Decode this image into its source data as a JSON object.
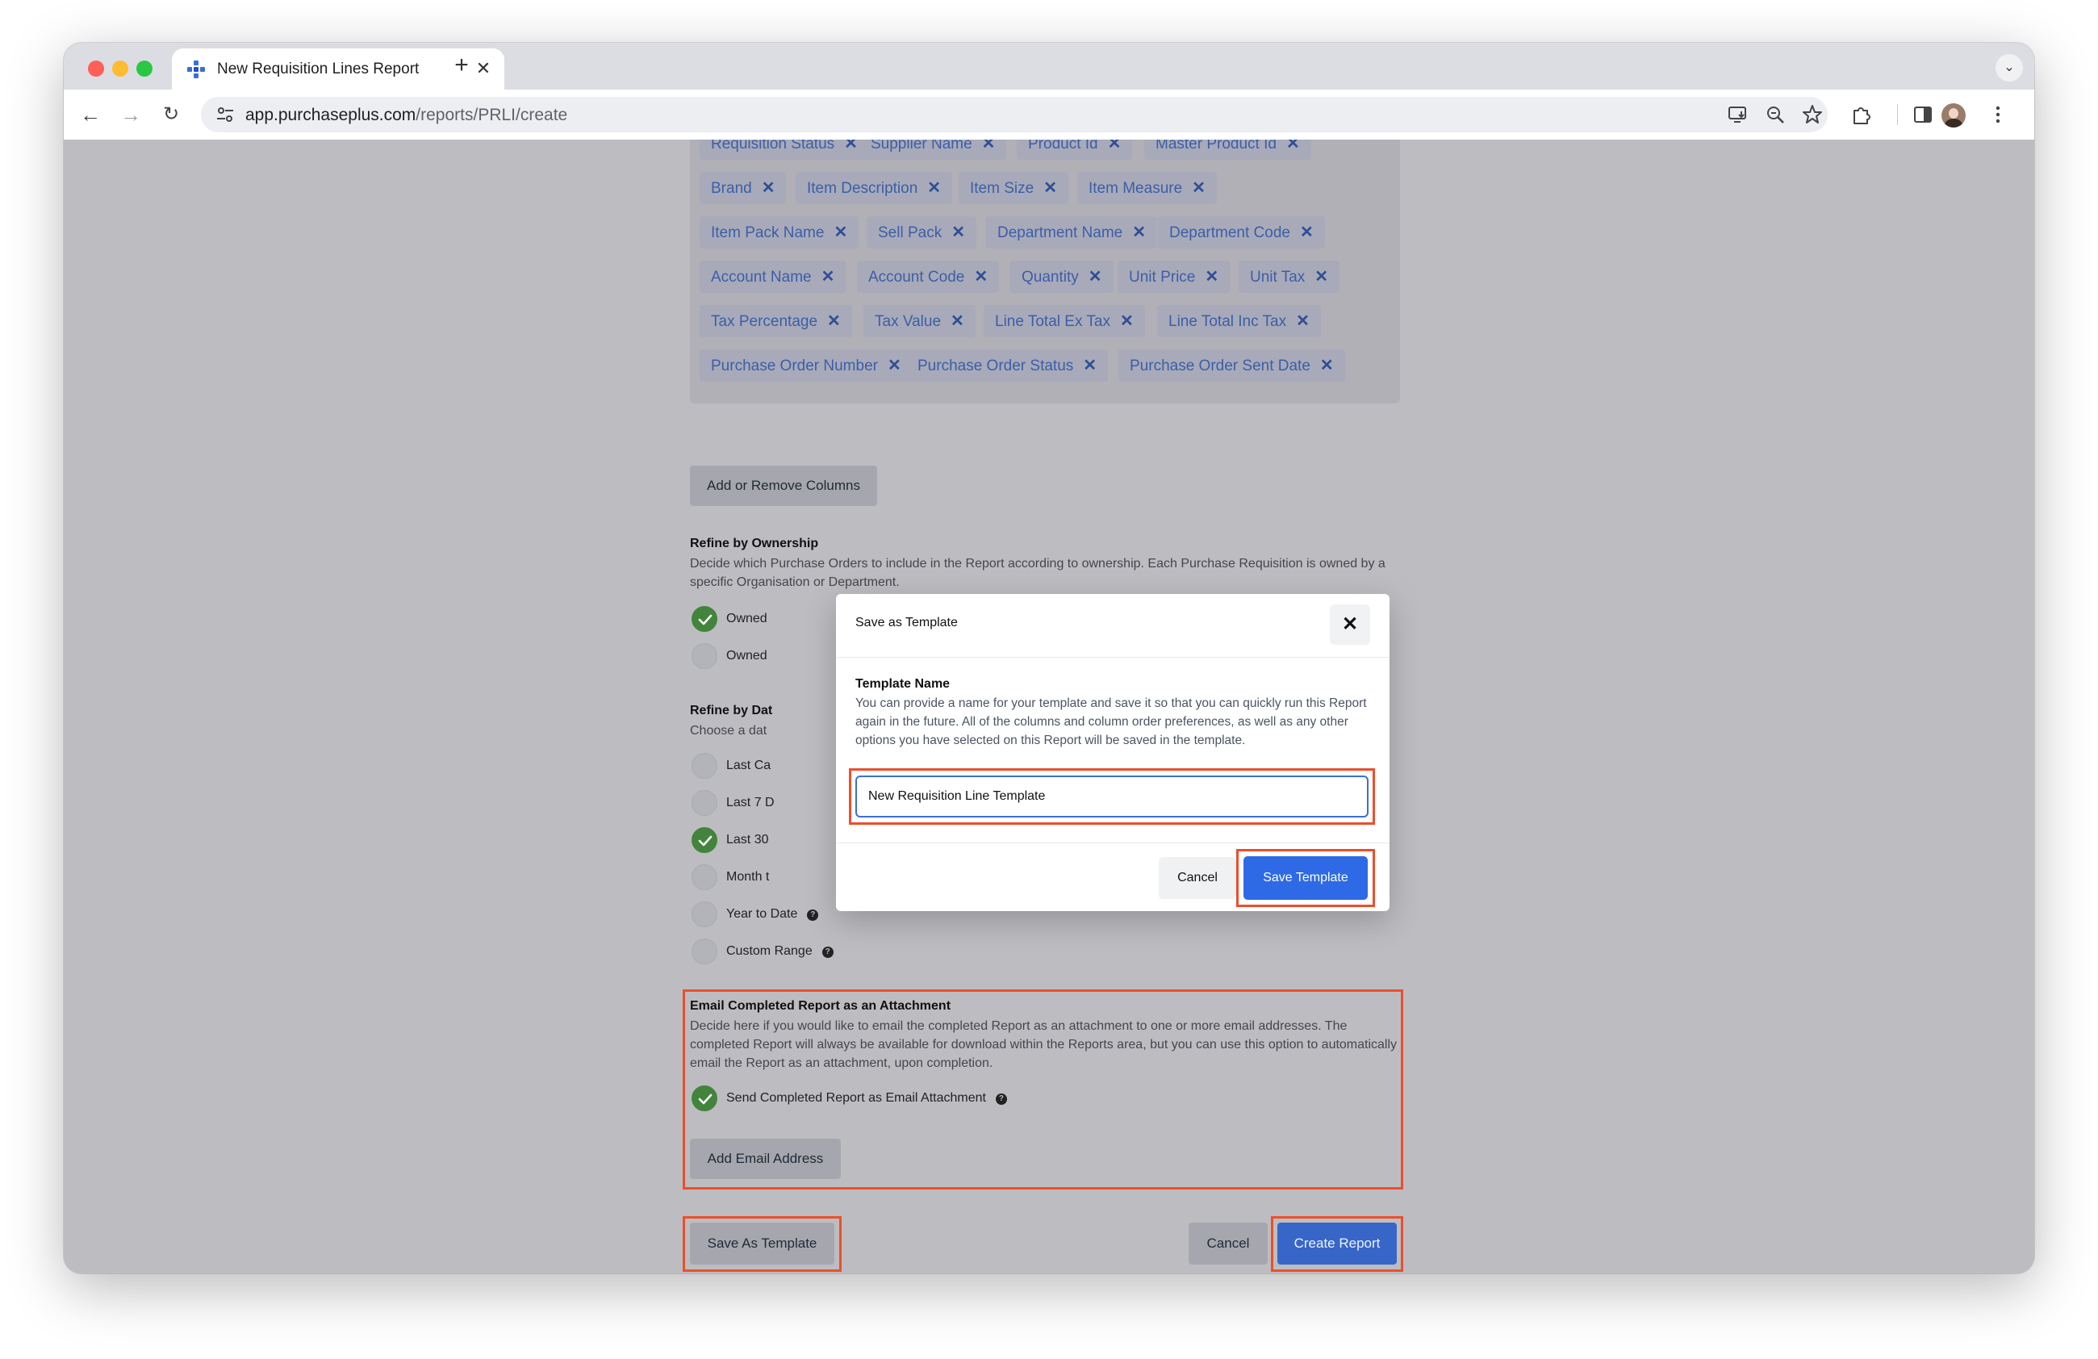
{
  "browser": {
    "tab_title": "New Requisition Lines Report",
    "url_host": "app.purchaseplus.com",
    "url_path": "/reports/PRLI/create"
  },
  "columns": {
    "chips": [
      "Requisition Status",
      "Supplier Name",
      "Product Id",
      "Master Product Id",
      "Brand",
      "Item Description",
      "Item Size",
      "Item Measure",
      "Item Pack Name",
      "Sell Pack",
      "Department Name",
      "Department Code",
      "Account Name",
      "Account Code",
      "Quantity",
      "Unit Price",
      "Unit Tax",
      "Tax Percentage",
      "Tax Value",
      "Line Total Ex Tax",
      "Line Total Inc Tax",
      "Purchase Order Number",
      "Purchase Order Status",
      "Purchase Order Sent Date"
    ],
    "add_remove_label": "Add or Remove Columns"
  },
  "ownership": {
    "title": "Refine by Ownership",
    "description": "Decide which Purchase Orders to include in the Report according to ownership. Each Purchase Requisition is owned by a specific Organisation or Department.",
    "options": [
      {
        "label": "Owned",
        "checked": true
      },
      {
        "label": "Owned",
        "checked": false
      }
    ]
  },
  "date": {
    "title": "Refine by Dat",
    "description": "Choose a dat",
    "options": [
      {
        "label": "Last Ca",
        "checked": false
      },
      {
        "label": "Last 7 D",
        "checked": false
      },
      {
        "label": "Last 30",
        "checked": true
      },
      {
        "label": "Month t",
        "checked": false
      },
      {
        "label": "Year to Date",
        "checked": false
      },
      {
        "label": "Custom Range",
        "checked": false
      }
    ]
  },
  "email": {
    "title": "Email Completed Report as an Attachment",
    "description": "Decide here if you would like to email the completed Report as an attachment to one or more email addresses. The completed Report will always be available for download within the Reports area, but you can use this option to automatically email the Report as an attachment, upon completion.",
    "option_label": "Send Completed Report as Email Attachment",
    "option_checked": true,
    "add_email_label": "Add Email Address"
  },
  "footer": {
    "save_as_template": "Save As Template",
    "cancel": "Cancel",
    "create_report": "Create Report"
  },
  "modal": {
    "title": "Save as Template",
    "field_label": "Template Name",
    "field_description": "You can provide a name for your template and save it so that you can quickly run this Report again in the future. All of the columns and column order preferences, as well as any other options you have selected on this Report will be saved in the template.",
    "input_value": "New Requisition Line Template",
    "cancel": "Cancel",
    "save": "Save Template"
  },
  "colors": {
    "highlight": "#ec4f2b",
    "primary": "#2f6ae6",
    "checked": "#43843d"
  }
}
